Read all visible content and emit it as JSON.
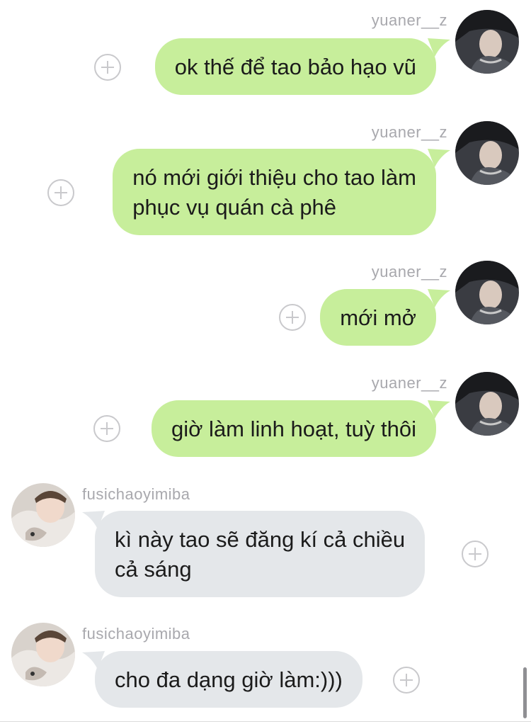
{
  "messages": [
    {
      "sender": "yuaner__z",
      "text": "ok thế để tao bảo hạo vũ"
    },
    {
      "sender": "yuaner__z",
      "line1": "nó mới giới thiệu cho tao làm",
      "line2": "phục vụ quán cà phê"
    },
    {
      "sender": "yuaner__z",
      "text": "mới mở"
    },
    {
      "sender": "yuaner__z",
      "text": "giờ làm linh hoạt, tuỳ thôi"
    },
    {
      "sender": "fusichaoyimiba",
      "line1": "kì này tao sẽ đăng kí cả chiều",
      "line2": "cả sáng"
    },
    {
      "sender": "fusichaoyimiba",
      "text": "cho đa dạng giờ làm:)))"
    }
  ],
  "icons": {
    "add_reaction": "plus-circle-icon",
    "avatar_out": "avatar-dark-photo",
    "avatar_in": "avatar-light-photo"
  },
  "colors": {
    "outgoing_bubble": "#c7ee9b",
    "incoming_bubble": "#e4e7ea",
    "sender_name": "#a8a8ad"
  }
}
